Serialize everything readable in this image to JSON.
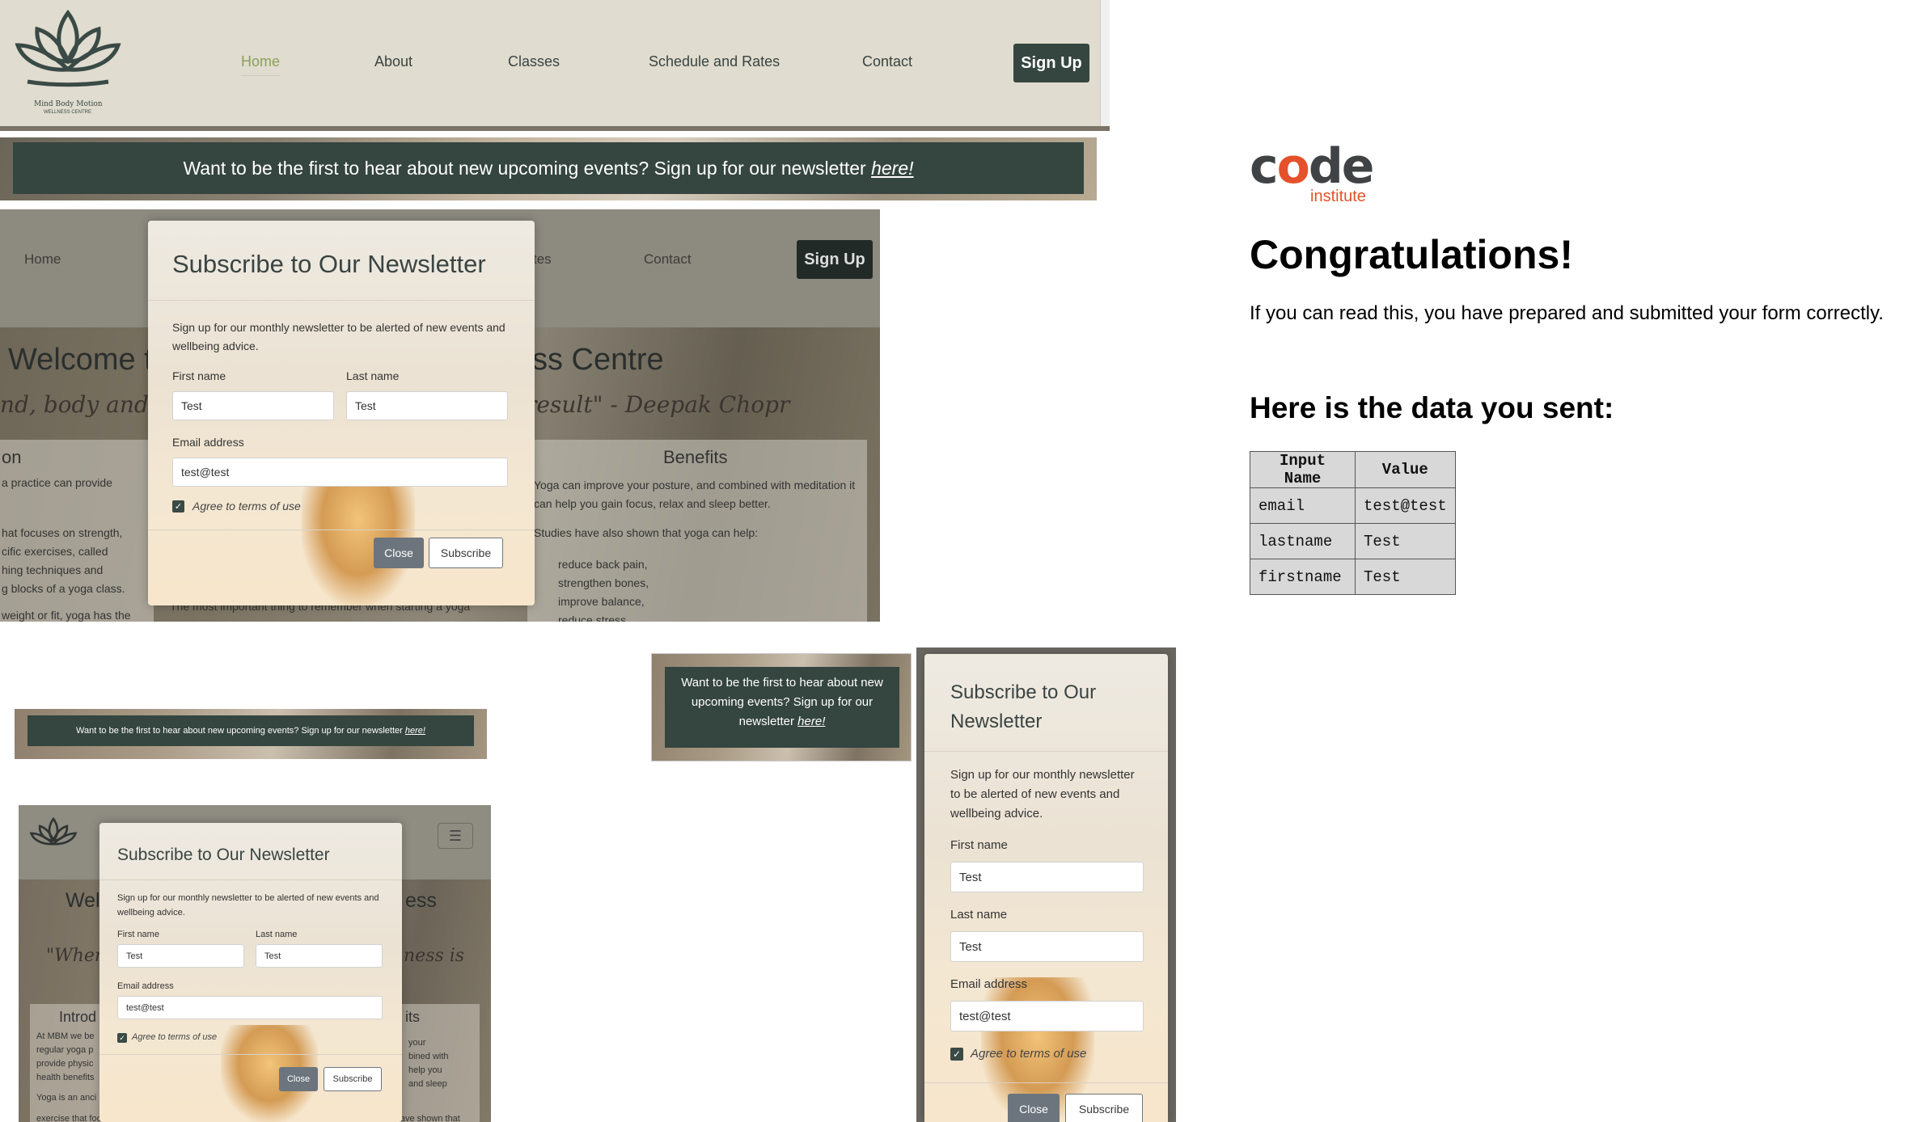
{
  "header": {
    "logo_text": "Mind Body Motion",
    "logo_sub": "WELLNESS CENTRE",
    "nav": [
      "Home",
      "About",
      "Classes",
      "Schedule and Rates",
      "Contact"
    ],
    "signup": "Sign Up"
  },
  "banner": {
    "text": "Want to be the first to hear about new upcoming events? Sign up for our newsletter ",
    "link": "here!"
  },
  "modal": {
    "title": "Subscribe to Our Newsletter",
    "title_l1": "Subscribe to Our",
    "title_l2": "Newsletter",
    "desc": "Sign up for our monthly newsletter to be alerted of new events and wellbeing advice.",
    "first_label": "First name",
    "first_value": "Test",
    "last_label": "Last name",
    "last_value": "Test",
    "email_label": "Email address",
    "email_value": "test@test",
    "terms": "Agree to terms of use",
    "close": "Close",
    "subscribe": "Subscribe"
  },
  "bg_page": {
    "nav_home": "Home",
    "nav_classes_frag": "tes",
    "nav_contact": "Contact",
    "welcome_left": "Welcome t",
    "welcome_right": "ss Centre",
    "quote_left": "nd, body and spi",
    "quote_right": "result\" - Deepak Chopr",
    "left_h": "on",
    "left_p1": "a practice can provide",
    "left_p2a": "hat focuses on strength,",
    "left_p2b": "cific exercises, called",
    "left_p2c": "hing techniques and",
    "left_p2d": "g blocks of a yoga class.",
    "left_p3": "weight or fit, yoga has the",
    "benefits_h": "Benefits",
    "benefits_p1": "Yoga can improve your posture, and combined with meditation it can help you gain focus, relax and sleep better.",
    "benefits_p2": "Studies have also shown that yoga can help:",
    "benefits_list": [
      "reduce back pain,",
      "strengthen bones,",
      "improve balance,",
      "reduce stress"
    ],
    "bottom": "The most important thing to remember when starting a yoga"
  },
  "small_page": {
    "welcome_l": "Wel",
    "welcome_r": "ess",
    "quote_l": "\"When y",
    "quote_r": "ness is",
    "intro_h": "Introd",
    "intro_p": [
      "At MBM we be",
      "regular yoga p",
      "provide physic",
      "health benefits"
    ],
    "intro_p2": "Yoga is an anci",
    "intro_p3": "exercise that focuses on",
    "benefits_frag": "its",
    "ben_lines": [
      "your",
      "bined with",
      "help you",
      "and sleep"
    ],
    "bottom_frag": "Studies have shown that"
  },
  "ci": {
    "logo_code": "code",
    "logo_institute": "institute",
    "heading": "Congratulations!",
    "message": "If you can read this, you have prepared and submitted your form correctly.",
    "data_heading": "Here is the data you sent:",
    "table_headers": [
      "Input Name",
      "Value"
    ],
    "rows": [
      [
        "email",
        "test@test"
      ],
      [
        "lastname",
        "Test"
      ],
      [
        "firstname",
        "Test"
      ]
    ]
  },
  "colors": {
    "dark_green": "#35453f",
    "beige": "#e0dccf",
    "ci_orange": "#e5512a"
  }
}
